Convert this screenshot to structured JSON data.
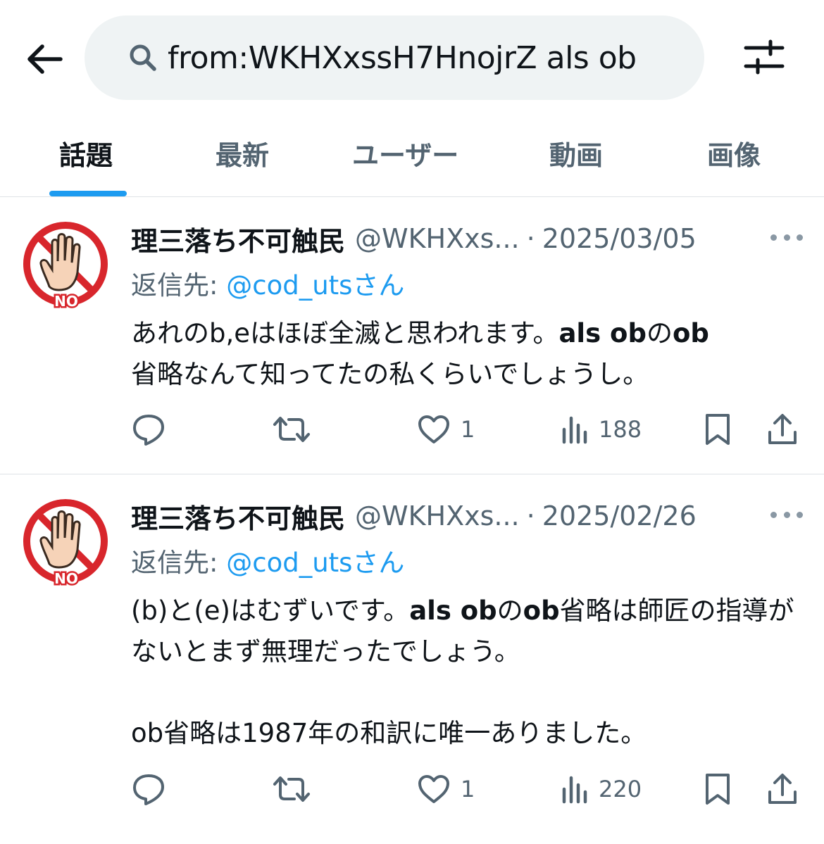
{
  "search": {
    "query": "from:WKHXxssH7HnojrZ als ob"
  },
  "tabs": [
    {
      "label": "話題"
    },
    {
      "label": "最新"
    },
    {
      "label": "ユーザー"
    },
    {
      "label": "動画"
    },
    {
      "label": "画像"
    }
  ],
  "tweets": [
    {
      "name": "理三落ち不可触民",
      "handle": "@WKHXxs...",
      "separator": "·",
      "date": "2025/03/05",
      "reply_prefix": "返信先: ",
      "reply_to": "@cod_uts",
      "reply_suffix": "さん",
      "body": {
        "p1_a": "あれのb,eはほぼ全滅と思われます。",
        "p1_b": "als ob",
        "p1_c": "の",
        "p1_d": "ob",
        "p1_e": "省略なんて知ってたの私くらいでしょうし。"
      },
      "likes": "1",
      "views": "188"
    },
    {
      "name": "理三落ち不可触民",
      "handle": "@WKHXxs...",
      "separator": "·",
      "date": "2025/02/26",
      "reply_prefix": "返信先: ",
      "reply_to": "@cod_uts",
      "reply_suffix": "さん",
      "body": {
        "p1_a": "(b)と(e)はむずいです。",
        "p1_b": "als ob",
        "p1_c": "の",
        "p1_d": "ob",
        "p1_e": "省略は師匠の指導がないとまず無理だったでしょう。",
        "p2": "ob省略は1987年の和訳に唯一ありました。"
      },
      "likes": "1",
      "views": "220"
    }
  ],
  "avatar": {
    "badge_text": "NO",
    "ring_color": "#d8262c"
  },
  "colors": {
    "accent": "#1d9bf0",
    "secondary_text": "#536471",
    "primary_text": "#0f1419"
  }
}
